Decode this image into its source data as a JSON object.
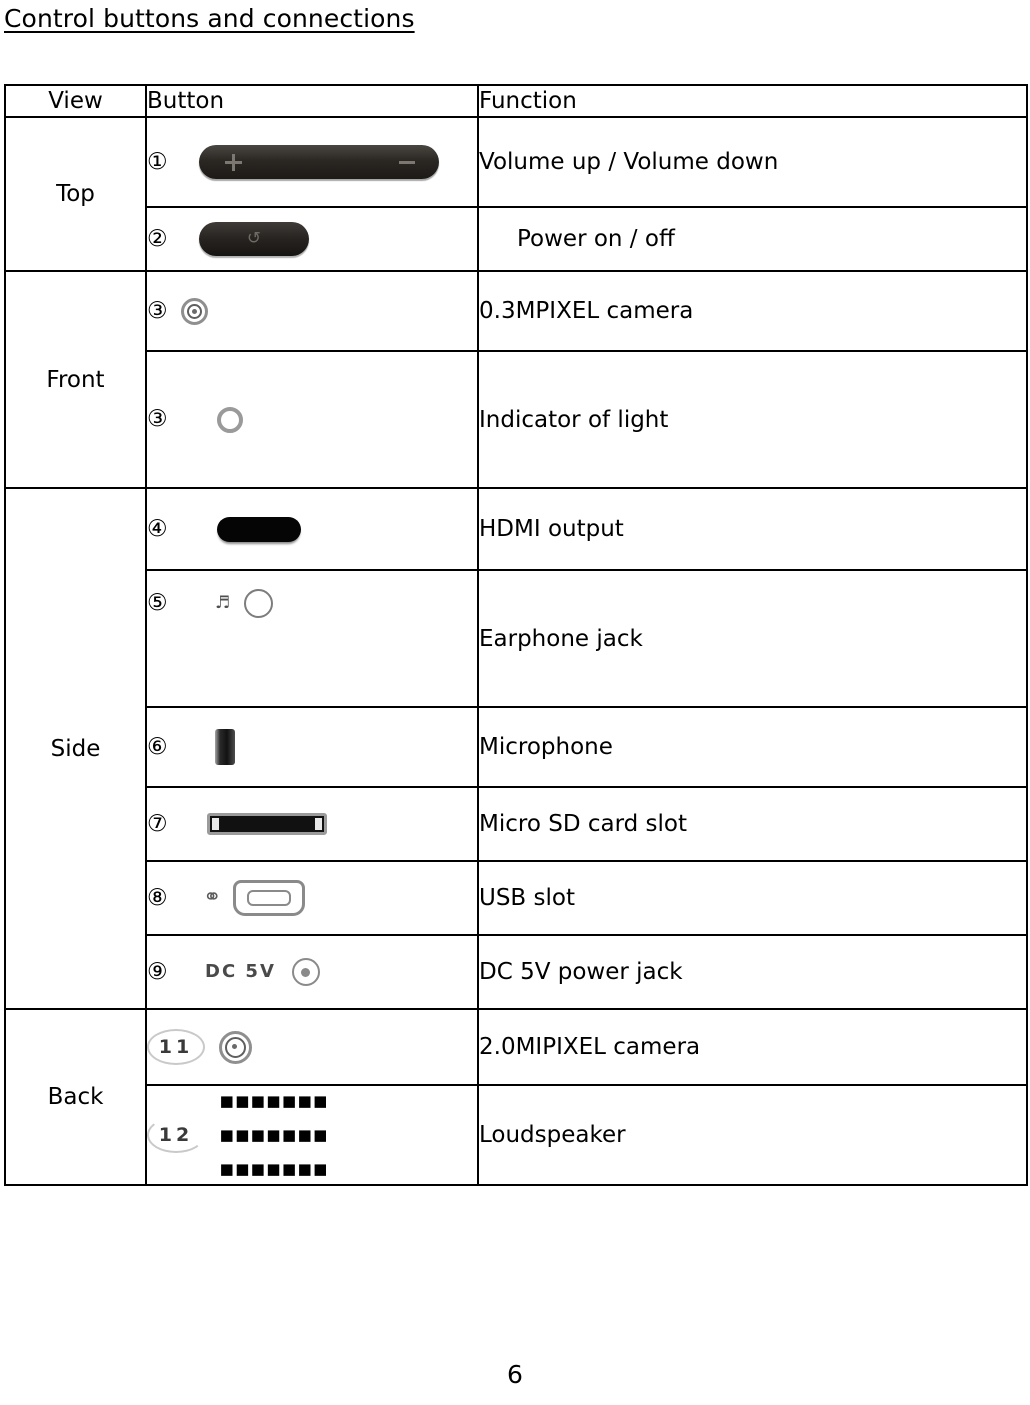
{
  "document": {
    "heading": "Control buttons and connections",
    "page_number": "6"
  },
  "table": {
    "columns": {
      "view": "View",
      "button": "Button",
      "function": "Function"
    },
    "groups": [
      {
        "view": "Top",
        "rows": [
          {
            "number": "①",
            "icon": "volume-rocker-icon",
            "function": "Volume up / Volume down"
          },
          {
            "number": "②",
            "icon": "power-button-icon",
            "function": "Power on / off"
          }
        ]
      },
      {
        "view": "Front",
        "rows": [
          {
            "number": "③",
            "icon": "camera-lens-icon",
            "function": "0.3MPIXEL camera"
          },
          {
            "number": "③",
            "icon": "indicator-light-icon",
            "function": "Indicator of light"
          }
        ]
      },
      {
        "view": "Side",
        "rows": [
          {
            "number": "④",
            "icon": "hdmi-port-icon",
            "function": "HDMI output"
          },
          {
            "number": "⑤",
            "icon": "earphone-jack-icon",
            "function": "Earphone jack"
          },
          {
            "number": "⑥",
            "icon": "microphone-icon",
            "function": "Microphone"
          },
          {
            "number": "⑦",
            "icon": "micro-sd-slot-icon",
            "function": "Micro SD card slot"
          },
          {
            "number": "⑧",
            "icon": "usb-port-icon",
            "function": "USB slot"
          },
          {
            "number": "⑨",
            "icon": "dc-power-jack-icon",
            "function": "DC 5V power jack",
            "icon_label": "DC 5V"
          }
        ]
      },
      {
        "view": "Back",
        "rows": [
          {
            "number": "11",
            "icon": "camera-lens-icon",
            "function": "2.0MIPIXEL camera"
          },
          {
            "number": "12",
            "icon": "loudspeaker-grille-icon",
            "function": "Loudspeaker"
          }
        ]
      }
    ]
  }
}
